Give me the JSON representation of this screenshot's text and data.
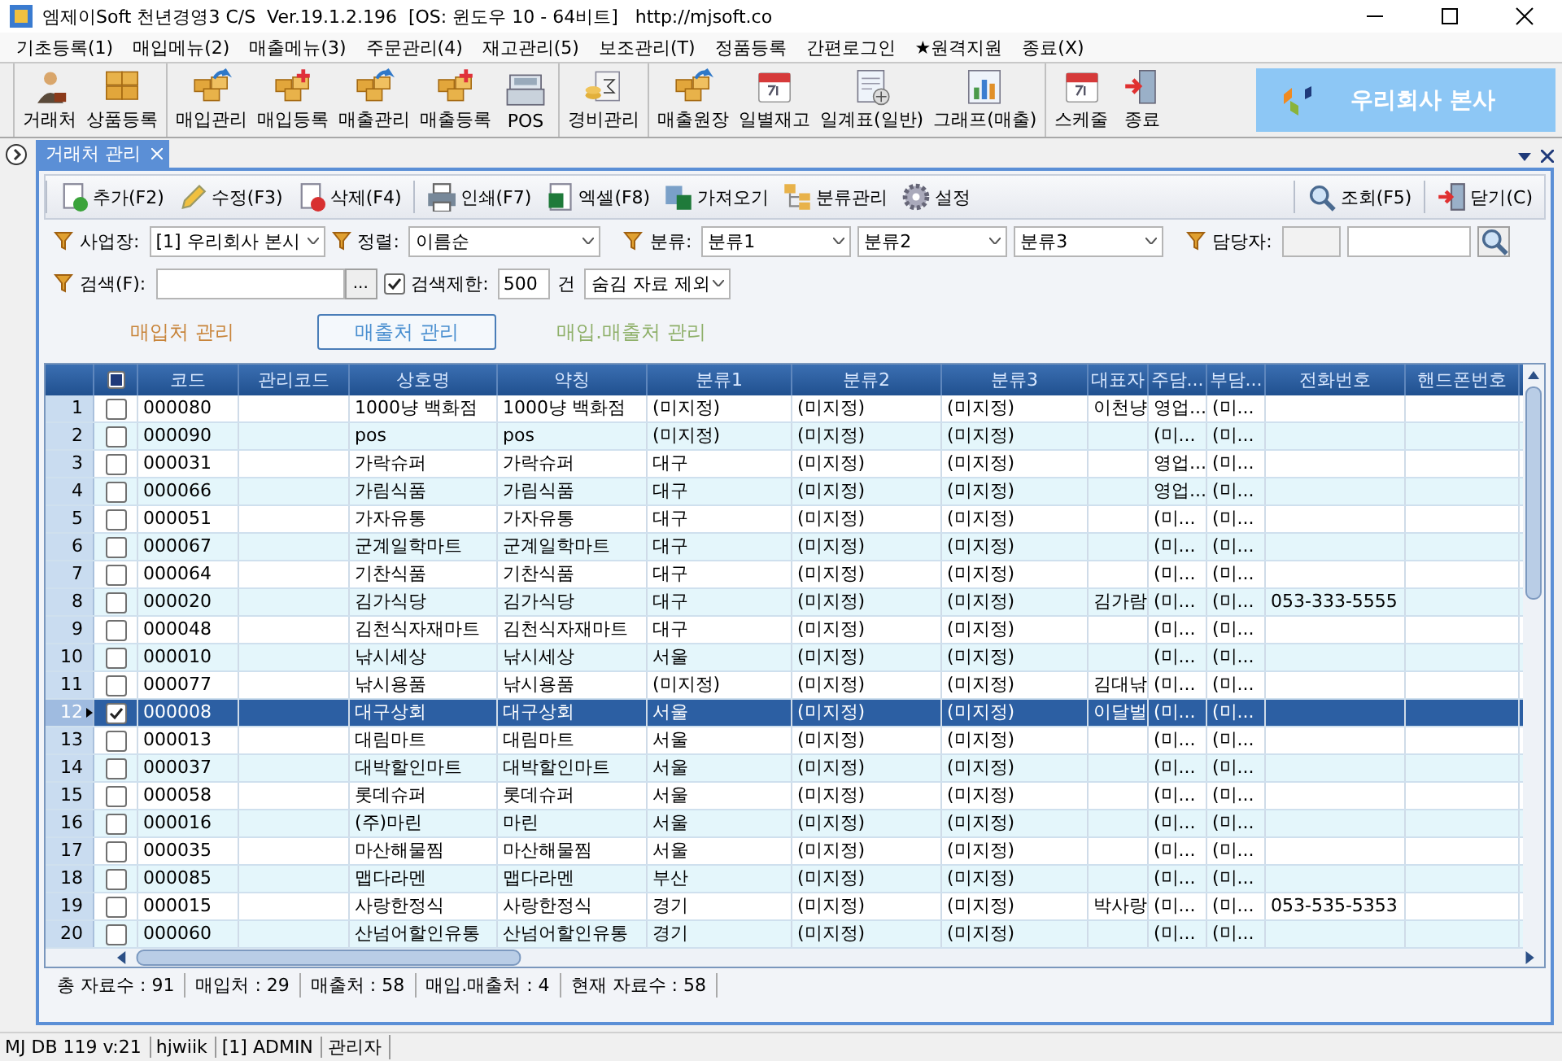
{
  "window": {
    "title": "엠제이Soft 천년경영3 C/S  Ver.19.1.2.196  [OS: 윈도우 10 - 64비트]   http://mjsoft.co"
  },
  "menu": [
    "기초등록(1)",
    "매입메뉴(2)",
    "매출메뉴(3)",
    "주문관리(4)",
    "재고관리(5)",
    "보조관리(T)",
    "정품등록",
    "간편로그인",
    "★원격지원",
    "종료(X)"
  ],
  "toolbar": [
    {
      "items": [
        "거래처",
        "상품등록"
      ]
    },
    {
      "items": [
        "매입관리",
        "매입등록",
        "매출관리",
        "매출등록",
        "POS"
      ]
    },
    {
      "items": [
        "경비관리"
      ]
    },
    {
      "items": [
        "매출원장",
        "일별재고",
        "일계표(일반)",
        "그래프(매출)"
      ]
    },
    {
      "items": [
        "스케줄",
        "종료"
      ]
    }
  ],
  "company": "우리회사 본사",
  "tabs": [
    {
      "label": "거래처 관리",
      "selected": true
    }
  ],
  "panel_toolbar": {
    "left": [
      [
        "추가(F2)",
        "수정(F3)",
        "삭제(F4)"
      ],
      [
        "인쇄(F7)",
        "엑셀(F8)",
        "가져오기",
        "분류관리",
        "설정"
      ]
    ],
    "right": [
      [
        "조회(F5)"
      ],
      [
        "닫기(C)"
      ]
    ]
  },
  "filters": {
    "site_label": "사업장:",
    "site": "[1] 우리회사 본시",
    "sort_label": "정렬:",
    "sort": "이름순",
    "class_label": "분류:",
    "class": [
      "분류1",
      "분류2",
      "분류3"
    ],
    "manager_label": "담당자:",
    "search_label": "검색(F):",
    "ellipsis": "...",
    "limit_checked": true,
    "limit_label": "검색제한:",
    "limit": "500",
    "limit_unit": "건",
    "hidden": "숨김 자료 제외"
  },
  "subtabs": [
    {
      "label": "매입처 관리",
      "selected": false,
      "color": "#c8843a"
    },
    {
      "label": "매출처 관리",
      "selected": true,
      "color": "#4a8fd0"
    },
    {
      "label": "매입.매출처 관리",
      "selected": false,
      "color": "#8fb06a"
    }
  ],
  "table": {
    "header_indeterminate": true,
    "columns": [
      "코드",
      "관리코드",
      "상호명",
      "약칭",
      "분류1",
      "분류2",
      "분류3",
      "대표자",
      "주담...",
      "부담...",
      "전화번호",
      "핸드폰번호"
    ],
    "rows": [
      {
        "no": "1",
        "checked": false,
        "selected": false,
        "cells": [
          "000080",
          "",
          "1000냥 백화점",
          "1000냥 백화점",
          "(미지정)",
          "(미지정)",
          "(미지정)",
          "이천냥",
          "영업...",
          "(미...",
          "",
          ""
        ]
      },
      {
        "no": "2",
        "checked": false,
        "selected": false,
        "cells": [
          "000090",
          "",
          "pos",
          "pos",
          "(미지정)",
          "(미지정)",
          "(미지정)",
          "",
          "(미...",
          "(미...",
          "",
          ""
        ]
      },
      {
        "no": "3",
        "checked": false,
        "selected": false,
        "cells": [
          "000031",
          "",
          "가락슈퍼",
          "가락슈퍼",
          "대구",
          "(미지정)",
          "(미지정)",
          "",
          "영업...",
          "(미...",
          "",
          ""
        ]
      },
      {
        "no": "4",
        "checked": false,
        "selected": false,
        "cells": [
          "000066",
          "",
          "가림식품",
          "가림식품",
          "대구",
          "(미지정)",
          "(미지정)",
          "",
          "영업...",
          "(미...",
          "",
          ""
        ]
      },
      {
        "no": "5",
        "checked": false,
        "selected": false,
        "cells": [
          "000051",
          "",
          "가자유통",
          "가자유통",
          "대구",
          "(미지정)",
          "(미지정)",
          "",
          "(미...",
          "(미...",
          "",
          ""
        ]
      },
      {
        "no": "6",
        "checked": false,
        "selected": false,
        "cells": [
          "000067",
          "",
          "군계일학마트",
          "군계일학마트",
          "대구",
          "(미지정)",
          "(미지정)",
          "",
          "(미...",
          "(미...",
          "",
          ""
        ]
      },
      {
        "no": "7",
        "checked": false,
        "selected": false,
        "cells": [
          "000064",
          "",
          "기찬식품",
          "기찬식품",
          "대구",
          "(미지정)",
          "(미지정)",
          "",
          "(미...",
          "(미...",
          "",
          ""
        ]
      },
      {
        "no": "8",
        "checked": false,
        "selected": false,
        "cells": [
          "000020",
          "",
          "김가식당",
          "김가식당",
          "대구",
          "(미지정)",
          "(미지정)",
          "김가람",
          "(미...",
          "(미...",
          "053-333-5555",
          ""
        ]
      },
      {
        "no": "9",
        "checked": false,
        "selected": false,
        "cells": [
          "000048",
          "",
          "김천식자재마트",
          "김천식자재마트",
          "대구",
          "(미지정)",
          "(미지정)",
          "",
          "(미...",
          "(미...",
          "",
          ""
        ]
      },
      {
        "no": "10",
        "checked": false,
        "selected": false,
        "cells": [
          "000010",
          "",
          "낚시세상",
          "낚시세상",
          "서울",
          "(미지정)",
          "(미지정)",
          "",
          "(미...",
          "(미...",
          "",
          ""
        ]
      },
      {
        "no": "11",
        "checked": false,
        "selected": false,
        "cells": [
          "000077",
          "",
          "낚시용품",
          "낚시용품",
          "(미지정)",
          "(미지정)",
          "(미지정)",
          "김대낚",
          "(미...",
          "(미...",
          "",
          ""
        ]
      },
      {
        "no": "12",
        "checked": true,
        "selected": true,
        "cells": [
          "000008",
          "",
          "대구상회",
          "대구상회",
          "서울",
          "(미지정)",
          "(미지정)",
          "이달벌",
          "(미...",
          "(미...",
          "",
          ""
        ]
      },
      {
        "no": "13",
        "checked": false,
        "selected": false,
        "cells": [
          "000013",
          "",
          "대림마트",
          "대림마트",
          "서울",
          "(미지정)",
          "(미지정)",
          "",
          "(미...",
          "(미...",
          "",
          ""
        ]
      },
      {
        "no": "14",
        "checked": false,
        "selected": false,
        "cells": [
          "000037",
          "",
          "대박할인마트",
          "대박할인마트",
          "서울",
          "(미지정)",
          "(미지정)",
          "",
          "(미...",
          "(미...",
          "",
          ""
        ]
      },
      {
        "no": "15",
        "checked": false,
        "selected": false,
        "cells": [
          "000058",
          "",
          "롯데슈퍼",
          "롯데슈퍼",
          "서울",
          "(미지정)",
          "(미지정)",
          "",
          "(미...",
          "(미...",
          "",
          ""
        ]
      },
      {
        "no": "16",
        "checked": false,
        "selected": false,
        "cells": [
          "000016",
          "",
          "(주)마린",
          "마린",
          "서울",
          "(미지정)",
          "(미지정)",
          "",
          "(미...",
          "(미...",
          "",
          ""
        ]
      },
      {
        "no": "17",
        "checked": false,
        "selected": false,
        "cells": [
          "000035",
          "",
          "마산해물찜",
          "마산해물찜",
          "서울",
          "(미지정)",
          "(미지정)",
          "",
          "(미...",
          "(미...",
          "",
          ""
        ]
      },
      {
        "no": "18",
        "checked": false,
        "selected": false,
        "cells": [
          "000085",
          "",
          "맵다라멘",
          "맵다라멘",
          "부산",
          "(미지정)",
          "(미지정)",
          "",
          "(미...",
          "(미...",
          "",
          ""
        ]
      },
      {
        "no": "19",
        "checked": false,
        "selected": false,
        "cells": [
          "000015",
          "",
          "사랑한정식",
          "사랑한정식",
          "경기",
          "(미지정)",
          "(미지정)",
          "박사랑",
          "(미...",
          "(미...",
          "053-535-5353",
          ""
        ]
      },
      {
        "no": "20",
        "checked": false,
        "selected": false,
        "cells": [
          "000060",
          "",
          "산넘어할인유통",
          "산넘어할인유통",
          "경기",
          "(미지정)",
          "(미지정)",
          "",
          "(미...",
          "(미...",
          "",
          ""
        ]
      }
    ]
  },
  "panel_status": [
    "총 자료수 : 91",
    "매입처 : 29",
    "매출처 : 58",
    "매입.매출처 : 4",
    "현재 자료수 : 58"
  ],
  "status_bar": [
    "MJ DB 119 v:21",
    "hjwiik",
    "[1] ADMIN",
    "관리자"
  ]
}
